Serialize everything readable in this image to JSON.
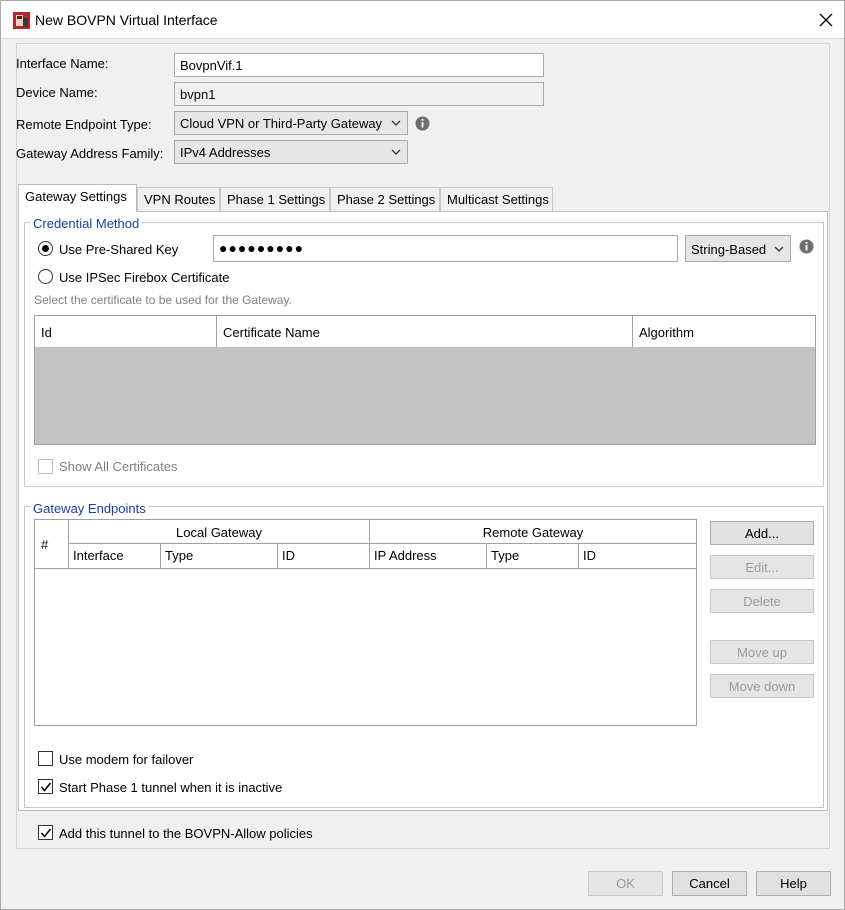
{
  "window": {
    "title": "New BOVPN Virtual Interface"
  },
  "form": {
    "interface_name_label": "Interface Name:",
    "interface_name_value": "BovpnVif.1",
    "device_name_label": "Device Name:",
    "device_name_value": "bvpn1",
    "remote_endpoint_label": "Remote Endpoint Type:",
    "remote_endpoint_value": "Cloud VPN or Third-Party Gateway",
    "address_family_label": "Gateway Address Family:",
    "address_family_value": "IPv4 Addresses"
  },
  "tabs": [
    {
      "label": "Gateway Settings"
    },
    {
      "label": "VPN Routes"
    },
    {
      "label": "Phase 1 Settings"
    },
    {
      "label": "Phase 2 Settings"
    },
    {
      "label": "Multicast Settings"
    }
  ],
  "credential": {
    "title": "Credential Method",
    "psk_label": "Use Pre-Shared Key",
    "psk_value": "●●●●●●●●●",
    "psk_type": "String-Based",
    "cert_label": "Use IPSec Firebox Certificate",
    "cert_hint": "Select the certificate to be used for the Gateway.",
    "cert_columns": [
      "Id",
      "Certificate Name",
      "Algorithm"
    ],
    "show_all_label": "Show All Certificates"
  },
  "endpoints": {
    "title": "Gateway Endpoints",
    "col_hash": "#",
    "local_group": "Local Gateway",
    "remote_group": "Remote Gateway",
    "local_cols": [
      "Interface",
      "Type",
      "ID"
    ],
    "remote_cols": [
      "IP Address",
      "Type",
      "ID"
    ],
    "buttons": {
      "add": "Add...",
      "edit": "Edit...",
      "delete": "Delete",
      "move_up": "Move up",
      "move_down": "Move down"
    },
    "modem_label": "Use modem for failover",
    "phase1_label": "Start Phase 1 tunnel when it is inactive"
  },
  "bovpn_allow_label": "Add this tunnel to the BOVPN-Allow policies",
  "footer": {
    "ok": "OK",
    "cancel": "Cancel",
    "help": "Help"
  }
}
